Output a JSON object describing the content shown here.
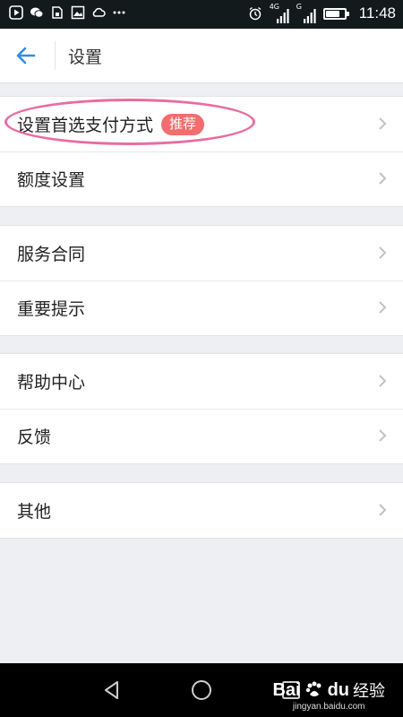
{
  "status_bar": {
    "left_icons": [
      "play-store-icon",
      "wechat-icon",
      "sim-cleaner-icon",
      "gallery-icon",
      "cloud-icon",
      "more-dots-icon"
    ],
    "network_1": "4G",
    "network_2": "G",
    "battery_level": 0.75,
    "time": "11:48"
  },
  "header": {
    "back_icon": "arrow-left-icon",
    "title": "设置"
  },
  "groups": [
    {
      "items": [
        {
          "label": "设置首选支付方式",
          "badge": "推荐"
        },
        {
          "label": "额度设置"
        }
      ]
    },
    {
      "items": [
        {
          "label": "服务合同"
        },
        {
          "label": "重要提示"
        }
      ]
    },
    {
      "items": [
        {
          "label": "帮助中心"
        },
        {
          "label": "反馈"
        }
      ]
    },
    {
      "items": [
        {
          "label": "其他"
        }
      ]
    }
  ],
  "annotation": {
    "highlight_color": "#e86ca0"
  },
  "colors": {
    "accent": "#2f8fe0",
    "badge": "#f26d6d",
    "background": "#eeeff3"
  },
  "nav_bar": {
    "buttons": [
      "back-triangle-icon",
      "home-circle-icon",
      "recents-square-icon"
    ]
  },
  "watermark": {
    "brand_a": "Bai",
    "brand_b": "du",
    "product": "经验",
    "url": "jingyan.baidu.com"
  }
}
